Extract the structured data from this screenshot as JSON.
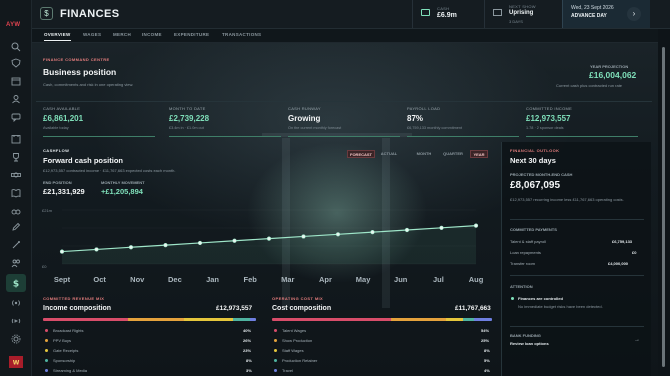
{
  "header": {
    "title": "FINANCES",
    "cash": {
      "label": "CASH",
      "value": "£6.9m"
    },
    "next_show": {
      "label": "NEXT SHOW",
      "name": "Uprising",
      "sub": "3 DAYS"
    },
    "date": {
      "date": "Wed, 23 Sept 2026",
      "action": "ADVANCE DAY"
    },
    "rail_logo": "AYW"
  },
  "tabs": [
    "OVERVIEW",
    "WAGES",
    "MERCH",
    "INCOME",
    "EXPENDITURE",
    "TRANSACTIONS"
  ],
  "command": {
    "section": "FINANCE COMMAND CENTRE",
    "title": "Business position",
    "subtitle": "Cash, commitments and risk in one operating view.",
    "projection_label": "YEAR PROJECTION",
    "projection_value": "£16,004,062",
    "projection_sub": "Current cash plus contracted run rate"
  },
  "kpis": [
    {
      "label": "CASH AVAILABLE",
      "value": "£6,861,201",
      "sub": "Available today",
      "color": "#7fe0ba"
    },
    {
      "label": "MONTH TO DATE",
      "value": "£2,739,228",
      "sub": "£3.4m in · £1.0m out",
      "color": "#7fe0ba"
    },
    {
      "label": "CASH RUNWAY",
      "value": "Growing",
      "sub": "On the current monthly forecast",
      "color": "#f4f6f7"
    },
    {
      "label": "PAYROLL LOAD",
      "value": "87%",
      "sub": "£6,759,133 monthly commitment",
      "color": "#f4f6f7"
    },
    {
      "label": "COMMITTED INCOME",
      "value": "£12,973,557",
      "sub": "1.78 · 2 sponsor deals",
      "color": "#7fe0ba"
    }
  ],
  "cashflow": {
    "section": "CASHFLOW",
    "title": "Forward cash position",
    "sub": "£12,973,557 contracted income · £11,767,663 expected costs each month.",
    "toggles": [
      "FORECAST",
      "ACTUAL"
    ],
    "ranges": [
      "MONTH",
      "QUARTER",
      "YEAR"
    ],
    "end_label": "END POSITION",
    "end_value": "£21,331,929",
    "move_label": "MONTHLY MOVEMENT",
    "move_value": "+£1,205,894"
  },
  "chart_data": {
    "type": "line",
    "title": "Forward cash position",
    "categories": [
      "Sept",
      "Oct",
      "Nov",
      "Dec",
      "Jan",
      "Feb",
      "Mar",
      "Apr",
      "May",
      "Jun",
      "Jul",
      "Aug"
    ],
    "x": [
      "Sept",
      "Oct",
      "Nov",
      "Dec",
      "Jan",
      "Feb",
      "Mar",
      "Apr",
      "May",
      "Jun",
      "Jul",
      "Aug"
    ],
    "series": [
      {
        "values": [
          6.9,
          8.1,
          9.3,
          10.5,
          11.7,
          12.9,
          14.1,
          15.3,
          16.5,
          17.7,
          18.9,
          20.1,
          21.3
        ]
      }
    ],
    "y_axis_labels": [
      "£21m",
      "£0"
    ],
    "ylim": [
      0,
      30
    ],
    "grid": true,
    "color": "#9fe6c9"
  },
  "outlook": {
    "section": "FINANCIAL OUTLOOK",
    "title": "Next 30 days",
    "proj_label": "PROJECTED MONTH-END CASH",
    "proj_value": "£8,067,095",
    "proj_sub": "£12,973,557 recurring income less £11,767,663 operating costs.",
    "committed_label": "COMMITTED PAYMENTS",
    "payments": [
      {
        "label": "Talent & staff payroll",
        "value": "£6,759,133"
      },
      {
        "label": "Loan repayments",
        "value": "£0"
      },
      {
        "label": "Transfer room",
        "value": "£4,000,000"
      }
    ],
    "attention_label": "ATTENTION",
    "attention_title": "Finances are controlled",
    "attention_sub": "No immediate budget risks have been detected.",
    "bank_label": "BANK FUNDING",
    "bank_title": "Review loan options"
  },
  "revenue": {
    "section": "COMMITTED REVENUE MIX",
    "title": "Income composition",
    "total": "£12,973,557",
    "items": [
      {
        "label": "Broadcast Rights",
        "pct": "40%",
        "color": "#d84d6a"
      },
      {
        "label": "PPV Buys",
        "pct": "26%",
        "color": "#e5a23c"
      },
      {
        "label": "Gate Receipts",
        "pct": "23%",
        "color": "#e5c63c"
      },
      {
        "label": "Sponsorship",
        "pct": "8%",
        "color": "#4fb3a0"
      },
      {
        "label": "Streaming & Media",
        "pct": "3%",
        "color": "#6e7fe0"
      }
    ]
  },
  "costs": {
    "section": "OPERATING COST MIX",
    "title": "Cost composition",
    "total": "£11,767,663",
    "items": [
      {
        "label": "Talent Wages",
        "pct": "54%",
        "color": "#d84d6a"
      },
      {
        "label": "Show Production",
        "pct": "25%",
        "color": "#e5a23c"
      },
      {
        "label": "Staff Wages",
        "pct": "8%",
        "color": "#e5c63c"
      },
      {
        "label": "Production Retainer",
        "pct": "5%",
        "color": "#4fb3a0"
      },
      {
        "label": "Travel",
        "pct": "4%",
        "color": "#6e7fe0"
      }
    ]
  }
}
